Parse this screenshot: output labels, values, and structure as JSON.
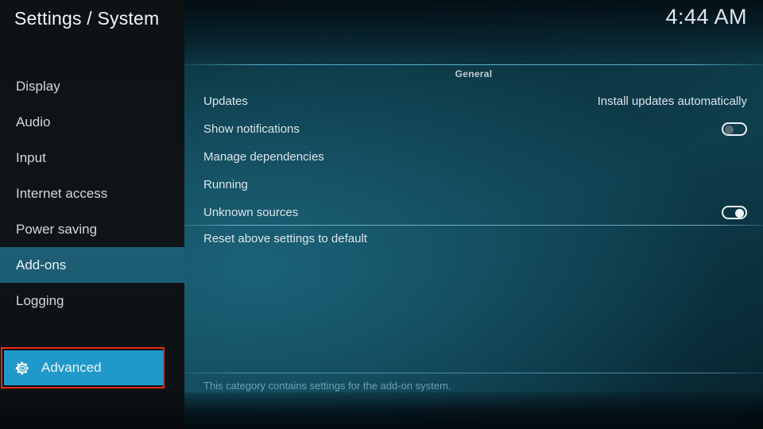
{
  "header": {
    "title": "Settings / System",
    "clock": "4:44 AM"
  },
  "sidebar": {
    "items": [
      {
        "label": "Display",
        "selected": false
      },
      {
        "label": "Audio",
        "selected": false
      },
      {
        "label": "Input",
        "selected": false
      },
      {
        "label": "Internet access",
        "selected": false
      },
      {
        "label": "Power saving",
        "selected": false
      },
      {
        "label": "Add-ons",
        "selected": true
      },
      {
        "label": "Logging",
        "selected": false
      }
    ],
    "focused_item": {
      "label": "Advanced",
      "icon": "gear-icon",
      "highlight_color": "#ee2a14",
      "background_color": "#2098ca"
    }
  },
  "content": {
    "group_header": "General",
    "settings": [
      {
        "label": "Updates",
        "control": "value",
        "value": "Install updates automatically"
      },
      {
        "label": "Show notifications",
        "control": "toggle",
        "value": "off"
      },
      {
        "label": "Manage dependencies",
        "control": "none",
        "value": ""
      },
      {
        "label": "Running",
        "control": "none",
        "value": ""
      },
      {
        "label": "Unknown sources",
        "control": "toggle",
        "value": "on"
      }
    ],
    "reset_label": "Reset above settings to default",
    "description": "This category contains settings for the add-on system."
  }
}
